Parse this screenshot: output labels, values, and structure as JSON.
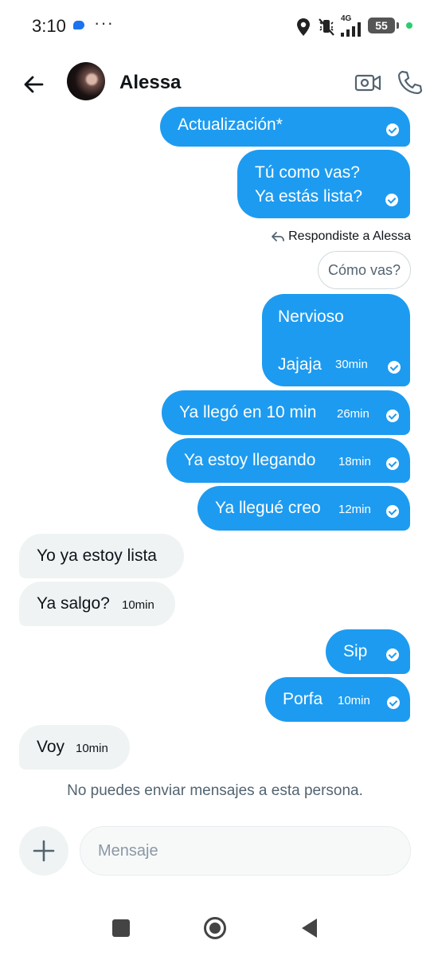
{
  "status_bar": {
    "time": "3:10",
    "dots": "···",
    "battery": "55",
    "network": "4G"
  },
  "header": {
    "contact_name": "Alessa"
  },
  "messages": [
    {
      "text": "Actualización*",
      "direction": "out"
    },
    {
      "text": "Tú como vas?\nYa estás lista?",
      "direction": "out"
    },
    {
      "text": "Nervioso\n\nJajaja",
      "time": "30min",
      "direction": "out"
    },
    {
      "text": "Ya llegó en 10 min",
      "time": "26min",
      "direction": "out"
    },
    {
      "text": "Ya estoy llegando",
      "time": "18min",
      "direction": "out"
    },
    {
      "text": "Ya llegué creo",
      "time": "12min",
      "direction": "out"
    },
    {
      "text": "Yo ya estoy lista",
      "direction": "in"
    },
    {
      "text": "Ya salgo?",
      "time": "10min",
      "direction": "in"
    },
    {
      "text": "Sip",
      "direction": "out"
    },
    {
      "text": "Porfa",
      "time": "10min",
      "direction": "out"
    },
    {
      "text": "Voy",
      "time": "10min",
      "direction": "in"
    }
  ],
  "reply": {
    "note": "Respondiste a Alessa",
    "quoted": "Cómo vas?"
  },
  "notice": "No puedes enviar mensajes a esta persona.",
  "composer": {
    "placeholder": "Mensaje"
  },
  "colors": {
    "outgoing_bubble": "#1d9bf0",
    "incoming_bubble": "#eff3f4",
    "notice_text": "#536471"
  },
  "icons": [
    "back-arrow-icon",
    "video-camera-icon",
    "phone-icon",
    "plus-icon",
    "location-icon",
    "mute-icon",
    "signal-icon",
    "battery-icon"
  ]
}
